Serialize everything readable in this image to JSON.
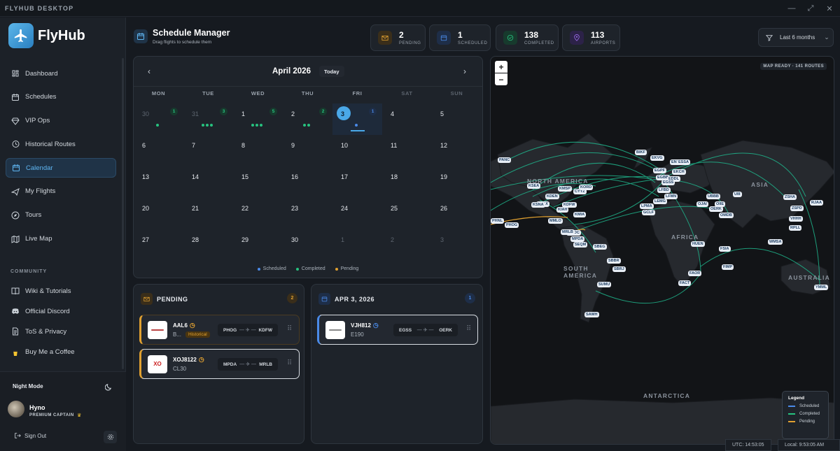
{
  "window": {
    "title": "FLYHUB DESKTOP"
  },
  "brand": {
    "name": "FlyHub",
    "accent": "#4aa8e8"
  },
  "nav": {
    "items": [
      {
        "label": "Dashboard",
        "icon": "gauge-icon"
      },
      {
        "label": "Schedules",
        "icon": "calendar-icon"
      },
      {
        "label": "VIP Ops",
        "icon": "diamond-icon"
      },
      {
        "label": "Historical Routes",
        "icon": "history-icon"
      },
      {
        "label": "Calendar",
        "icon": "calendar-icon",
        "active": true
      },
      {
        "label": "My Flights",
        "icon": "plane-icon"
      },
      {
        "label": "Tours",
        "icon": "compass-icon"
      },
      {
        "label": "Live Map",
        "icon": "map-icon"
      }
    ],
    "community_label": "COMMUNITY",
    "community": [
      {
        "label": "Wiki & Tutorials",
        "icon": "book-icon"
      },
      {
        "label": "Official Discord",
        "icon": "discord-icon"
      },
      {
        "label": "ToS & Privacy",
        "icon": "document-icon"
      },
      {
        "label": "Buy Me a Coffee",
        "icon": "coffee-icon"
      }
    ]
  },
  "footer": {
    "night_mode": "Night Mode",
    "user_name": "Hyno",
    "user_role": "PREMIUM CAPTAIN",
    "sign_out": "Sign Out"
  },
  "header": {
    "title": "Schedule Manager",
    "subtitle": "Drag flights to schedule them"
  },
  "stats": [
    {
      "value": "2",
      "label": "PENDING",
      "color": "#e0a030"
    },
    {
      "value": "1",
      "label": "SCHEDULED",
      "color": "#4a8ae8"
    },
    {
      "value": "138",
      "label": "COMPLETED",
      "color": "#27c27f"
    },
    {
      "value": "113",
      "label": "AIRPORTS",
      "color": "#9a6ae8"
    }
  ],
  "filter": {
    "label": "Last 6 months"
  },
  "calendar": {
    "month": "April 2026",
    "today_label": "Today",
    "weekdays": [
      "MON",
      "TUE",
      "WED",
      "THU",
      "FRI",
      "SAT",
      "SUN"
    ],
    "weeks": [
      [
        "30",
        "31",
        "1",
        "2",
        "3",
        "4",
        "5"
      ],
      [
        "6",
        "7",
        "8",
        "9",
        "10",
        "11",
        "12"
      ],
      [
        "13",
        "14",
        "15",
        "16",
        "17",
        "18",
        "19"
      ],
      [
        "20",
        "21",
        "22",
        "23",
        "24",
        "25",
        "26"
      ],
      [
        "27",
        "28",
        "29",
        "30",
        "1",
        "2",
        "3"
      ]
    ],
    "counts": {
      "d0": "1",
      "d1": "3",
      "d2": "5",
      "d3": "2",
      "d4": "1"
    },
    "legend": {
      "scheduled": "Scheduled",
      "completed": "Completed",
      "pending": "Pending"
    }
  },
  "pending": {
    "title": "PENDING",
    "count": "2",
    "flights": [
      {
        "callsign": "AAL6",
        "aircraft": "B...",
        "tag": "Historical",
        "from": "PHOG",
        "to": "KDFW"
      },
      {
        "callsign": "XOJ8122",
        "aircraft": "CL30",
        "from": "MPDA",
        "to": "MRLB"
      }
    ]
  },
  "day": {
    "title": "APR 3, 2026",
    "count": "1",
    "flights": [
      {
        "callsign": "VJH812",
        "aircraft": "E190",
        "from": "EGSS",
        "to": "OERK"
      }
    ]
  },
  "map": {
    "status": "MAP READY · 141 ROUTES",
    "zoom_in": "+",
    "zoom_out": "−",
    "continents": {
      "na": "NORTH AMERICA",
      "sa": "SOUTH AMERICA",
      "af": "AFRICA",
      "as": "ASIA",
      "au": "AUSTRALIA",
      "an": "ANTARCTICA"
    },
    "legend": {
      "title": "Legend",
      "scheduled": "Scheduled",
      "completed": "Completed",
      "pending": "Pending"
    },
    "airports": [
      "PANC",
      "BIKF",
      "EKVG",
      "ENBR",
      "ESSA",
      "EGPF",
      "EKCH",
      "EGBB",
      "EDDL",
      "LFBD",
      "LEMG",
      "LFMN",
      "LPMA",
      "GCLF",
      "UBBB",
      "OJAI",
      "OIIE",
      "OMDB",
      "UIII",
      "ZSHA",
      "RJAA",
      "ZSPD",
      "VHHH",
      "RPLL",
      "WMSA",
      "KSEA",
      "KMSP",
      "CYYZ",
      "KORD",
      "KDEN",
      "KLAX",
      "KSNA",
      "KIAH",
      "KMIA",
      "KDFW",
      "PHNL",
      "MMLO",
      "MROC",
      "SEQM",
      "SBEG",
      "SBBR",
      "SBRJ",
      "SUMU",
      "SAWH",
      "FAOR",
      "FACT",
      "FIMP",
      "FSIA",
      "HUEN",
      "YMML",
      "MPDA",
      "MRLB",
      "PHOG",
      "EGSS",
      "OERK"
    ]
  },
  "time": {
    "utc": "UTC: 14:53:05",
    "local": "Local: 9:53:05 AM"
  }
}
